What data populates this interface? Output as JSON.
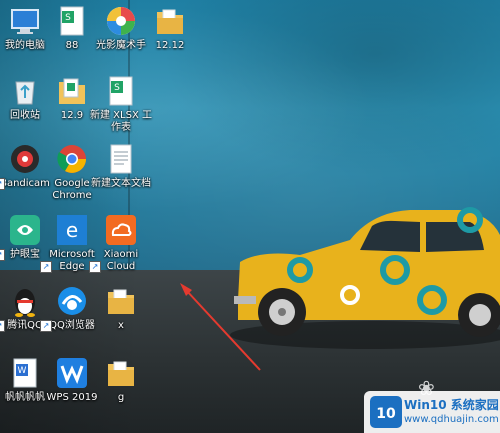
{
  "desktop": {
    "icons": [
      {
        "name": "my-computer-icon",
        "label": "我的电脑"
      },
      {
        "name": "88-spreadsheet-icon",
        "label": "88"
      },
      {
        "name": "guangying-icon",
        "label": "光影魔术手"
      },
      {
        "name": "folder-1212-icon",
        "label": "12.12"
      },
      {
        "name": "recycle-bin-icon",
        "label": "回收站"
      },
      {
        "name": "folder-129-icon",
        "label": "12.9"
      },
      {
        "name": "new-xlsx-icon",
        "label": "新建 XLSX 工作表"
      },
      {
        "name": "bandicam-icon",
        "label": "Bandicam"
      },
      {
        "name": "chrome-icon",
        "label": "Google Chrome"
      },
      {
        "name": "new-text-doc-icon",
        "label": "新建文本文档"
      },
      {
        "name": "eye-protect-icon",
        "label": "护眼宝"
      },
      {
        "name": "edge-icon",
        "label": "Microsoft Edge"
      },
      {
        "name": "xiaomi-cloud-icon",
        "label": "Xiaomi Cloud"
      },
      {
        "name": "qq-icon",
        "label": "腾讯QQ"
      },
      {
        "name": "qq-browser-icon",
        "label": "QQ浏览器"
      },
      {
        "name": "folder-x-icon",
        "label": "x"
      },
      {
        "name": "fanfan-icon",
        "label": "帆帆帆帆"
      },
      {
        "name": "wps-icon",
        "label": "WPS 2019"
      },
      {
        "name": "folder-g-icon",
        "label": "g"
      }
    ]
  },
  "watermark": {
    "title": "Win10 系统家园",
    "url": "www.qdhuajin.com"
  },
  "colors": {
    "wall": "#2a8fb2",
    "car": "#e8b21c",
    "arrow": "#e53a2f"
  }
}
